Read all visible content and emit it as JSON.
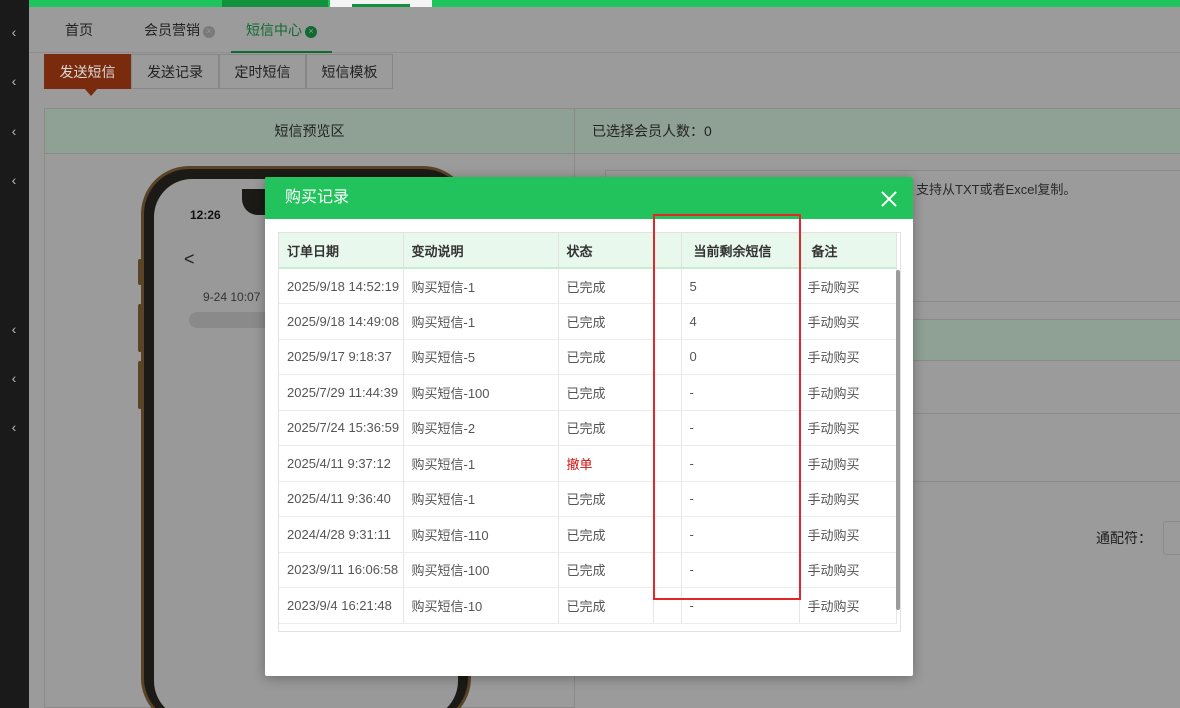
{
  "main_tabs": [
    {
      "label": "首页"
    },
    {
      "label": "会员营销"
    },
    {
      "label": "短信中心"
    }
  ],
  "close_glyph": "×",
  "sub_tabs": [
    {
      "label": "发送短信"
    },
    {
      "label": "发送记录"
    },
    {
      "label": "定时短信"
    },
    {
      "label": "短信模板"
    }
  ],
  "preview": {
    "header": "短信预览区",
    "phone_time": "12:26",
    "back_glyph": "<",
    "message_date": "9-24  10:07"
  },
  "right_panel": {
    "selected_count_label": "已选择会员人数：0",
    "paste_hint": "支持从TXT或者Excel复制。",
    "wildcard_label": "通配符："
  },
  "modal": {
    "title": "购买记录",
    "columns": [
      "订单日期",
      "变动说明",
      "状态",
      "",
      "当前剩余短信",
      "备注"
    ],
    "rows": [
      {
        "date": "2025/9/18 14:52:19",
        "desc": "购买短信-1",
        "status": "已完成",
        "remaining": "5",
        "note": "手动购买"
      },
      {
        "date": "2025/9/18 14:49:08",
        "desc": "购买短信-1",
        "status": "已完成",
        "remaining": "4",
        "note": "手动购买"
      },
      {
        "date": "2025/9/17 9:18:37",
        "desc": "购买短信-5",
        "status": "已完成",
        "remaining": "0",
        "note": "手动购买"
      },
      {
        "date": "2025/7/29 11:44:39",
        "desc": "购买短信-100",
        "status": "已完成",
        "remaining": "-",
        "note": "手动购买"
      },
      {
        "date": "2025/7/24 15:36:59",
        "desc": "购买短信-2",
        "status": "已完成",
        "remaining": "-",
        "note": "手动购买"
      },
      {
        "date": "2025/4/11 9:37:12",
        "desc": "购买短信-1",
        "status": "撤单",
        "remaining": "-",
        "note": "手动购买"
      },
      {
        "date": "2025/4/11 9:36:40",
        "desc": "购买短信-1",
        "status": "已完成",
        "remaining": "-",
        "note": "手动购买"
      },
      {
        "date": "2024/4/28 9:31:11",
        "desc": "购买短信-110",
        "status": "已完成",
        "remaining": "-",
        "note": "手动购买"
      },
      {
        "date": "2023/9/11 16:06:58",
        "desc": "购买短信-100",
        "status": "已完成",
        "remaining": "-",
        "note": "手动购买"
      },
      {
        "date": "2023/9/4 16:21:48",
        "desc": "购买短信-10",
        "status": "已完成",
        "remaining": "-",
        "note": "手动购买"
      }
    ]
  },
  "colors": {
    "brand_green": "#22c35c",
    "cancel_red": "#d01010",
    "highlight_red": "#e3262a"
  }
}
